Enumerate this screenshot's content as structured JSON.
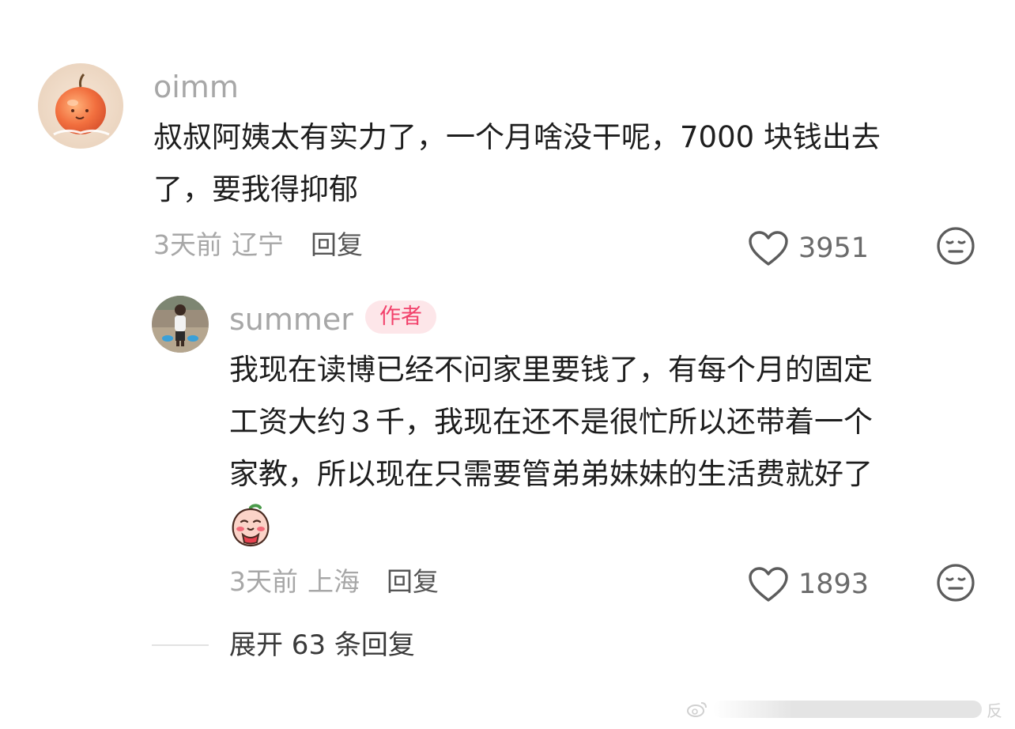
{
  "comment": {
    "username": "oimm",
    "content_lines": [
      "叔叔阿姨太有实力了，一个月啥没干呢，7000 块钱出去",
      "了，要我得抑郁"
    ],
    "time": "3天前",
    "location": "辽宁",
    "reply_label": "回复",
    "likes": "3951",
    "avatar_icon": "apple-avatar-icon",
    "dislike_icon": "dislike-face-icon",
    "like_icon": "heart-icon"
  },
  "reply": {
    "username": "summer",
    "badge": "作者",
    "content_lines": [
      "我现在读博已经不问家里要钱了，有每个月的固定",
      "工资大约３千，我现在还不是很忙所以还带着一个",
      "家教，所以现在只需要管弟弟妹妹的生活费就好了"
    ],
    "time": "3天前",
    "location": "上海",
    "reply_label": "回复",
    "likes": "1893",
    "avatar_icon": "child-photo-avatar-icon",
    "emoji_icon": "blushing-peach-emoji-icon"
  },
  "expand": {
    "label": "展开 63 条回复"
  },
  "watermark": {
    "text": "反"
  },
  "colors": {
    "username": "#a7a7a7",
    "text": "#1e1e1e",
    "badge_bg": "#fde6e9",
    "badge_text": "#f2416b"
  }
}
